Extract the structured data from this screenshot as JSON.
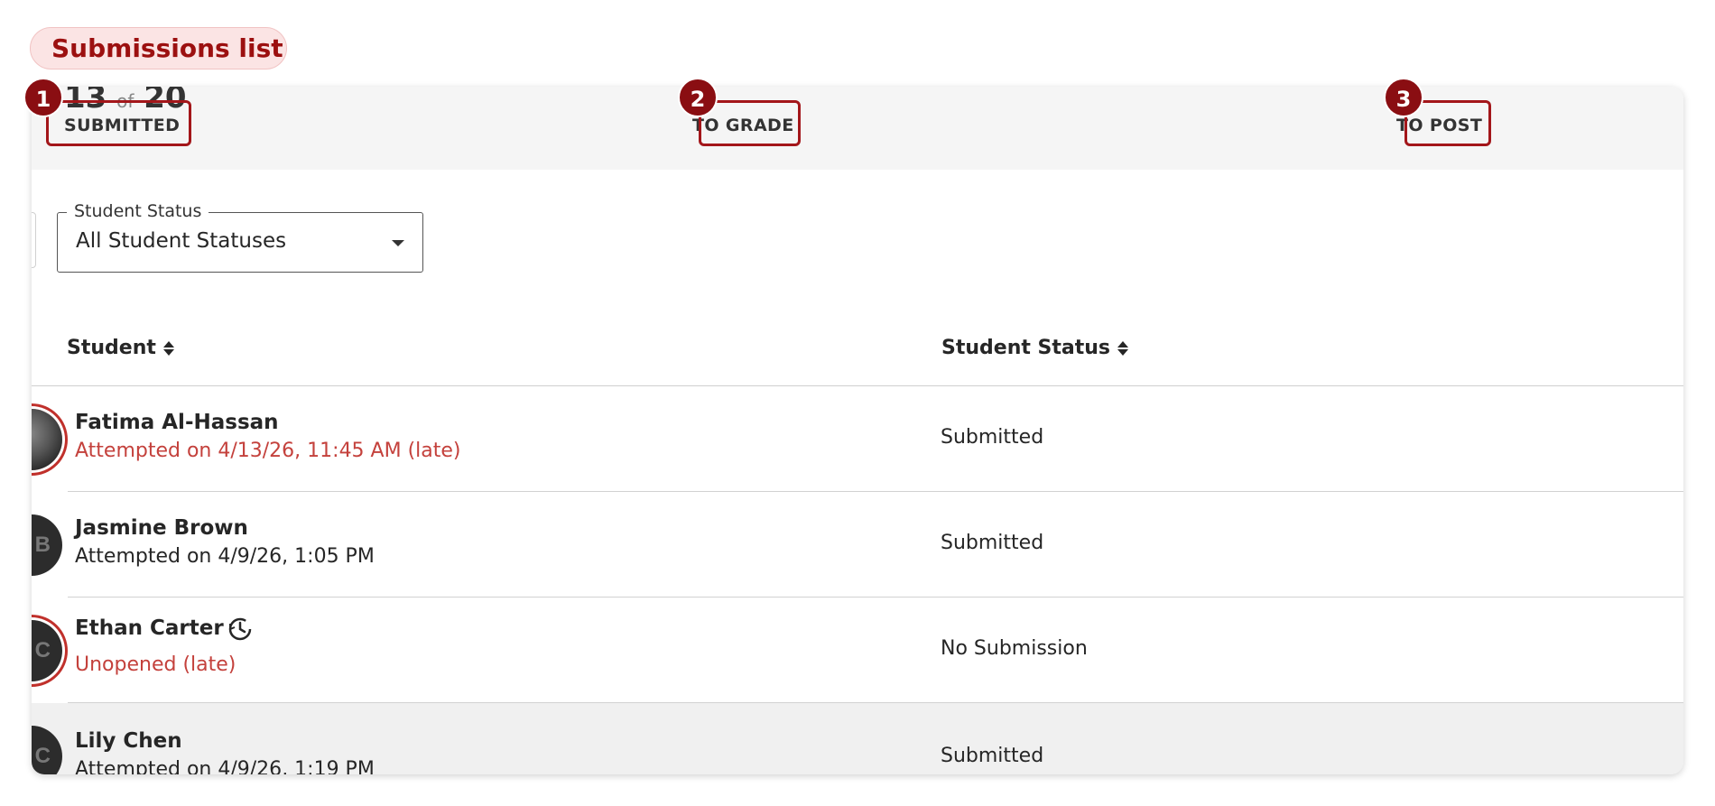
{
  "page": {
    "title": "Submissions list"
  },
  "stats": [
    {
      "number": "13",
      "of": "of",
      "total": "20",
      "label": "SUBMITTED",
      "badge": "1"
    },
    {
      "label": "TO GRADE",
      "badge": "2"
    },
    {
      "label": "TO POST",
      "badge": "3"
    }
  ],
  "filter": {
    "legend": "Student Status",
    "value": "All Student Statuses"
  },
  "table": {
    "headers": {
      "student": "Student",
      "status": "Student Status"
    },
    "rows": [
      {
        "name": "Fatima Al-Hassan",
        "detail": "Attempted on 4/13/26, 11:45 AM (late)",
        "status": "Submitted",
        "late": true,
        "initial": ""
      },
      {
        "name": "Jasmine Brown",
        "detail": "Attempted on 4/9/26, 1:05 PM",
        "status": "Submitted",
        "late": false,
        "initial": "B"
      },
      {
        "name": "Ethan Carter",
        "detail": "Unopened (late)",
        "status": "No Submission",
        "late": true,
        "initial": "C"
      },
      {
        "name": "Lily Chen",
        "detail": "Attempted on 4/9/26, 1:19 PM",
        "status": "Submitted",
        "late": false,
        "initial": "C"
      }
    ]
  },
  "colors": {
    "accent": "#9c1010",
    "callout": "#a3161a",
    "late": "#c4413c"
  },
  "icons": [
    "sort-icon",
    "caret-down-icon",
    "clock-history-icon",
    "avatar"
  ]
}
